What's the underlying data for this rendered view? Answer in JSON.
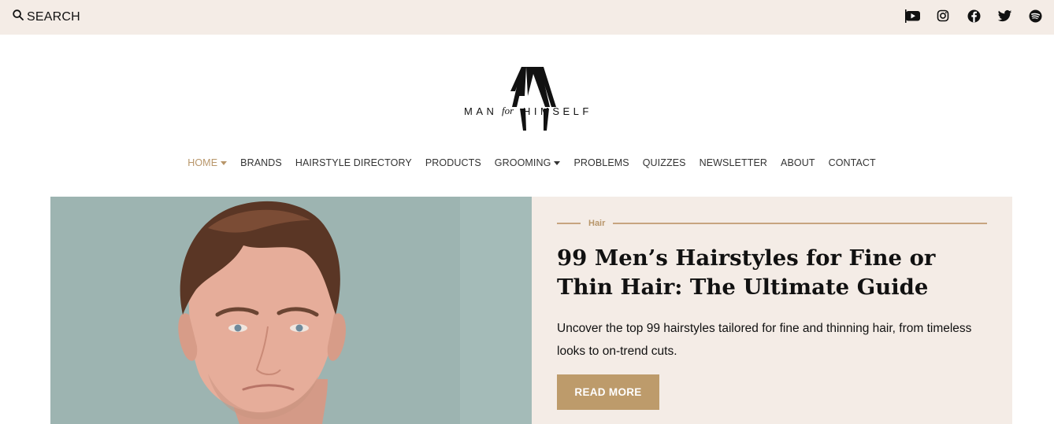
{
  "topbar": {
    "search_label": "SEARCH",
    "social_icons": [
      "youtube-icon",
      "instagram-icon",
      "facebook-icon",
      "twitter-icon",
      "spotify-icon"
    ]
  },
  "logo": {
    "left_text": "MAN",
    "for_text": "for",
    "right_text": "HIMSELF"
  },
  "nav": {
    "items": [
      {
        "label": "HOME",
        "has_dropdown": true,
        "active": true
      },
      {
        "label": "BRANDS"
      },
      {
        "label": "HAIRSTYLE DIRECTORY"
      },
      {
        "label": "PRODUCTS"
      },
      {
        "label": "GROOMING",
        "has_dropdown": true
      },
      {
        "label": "PROBLEMS"
      },
      {
        "label": "QUIZZES"
      },
      {
        "label": "NEWSLETTER"
      },
      {
        "label": "ABOUT"
      },
      {
        "label": "CONTACT"
      }
    ]
  },
  "featured": {
    "category": "Hair",
    "title": "99 Men’s Hairstyles for Fine or Thin Hair: The Ultimate Guide",
    "excerpt": "Uncover the top 99 hairstyles tailored for fine and thinning hair, from timeless looks to on-trend cuts.",
    "button_label": "READ MORE"
  },
  "colors": {
    "topbar_bg": "#f4ece6",
    "accent": "#bd9b6b",
    "nav_active": "#b8966a"
  }
}
